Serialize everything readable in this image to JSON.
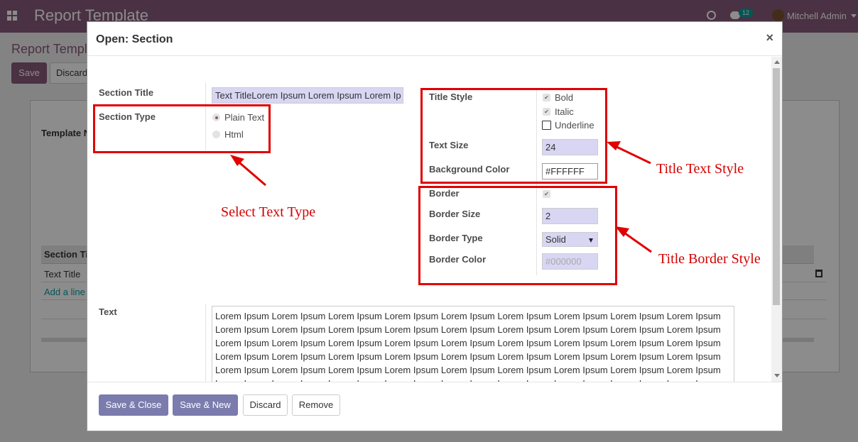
{
  "topbar": {
    "title": "Report Template",
    "badge": "12",
    "user": "Mitchell Admin"
  },
  "background": {
    "breadcrumb": "Report Templ",
    "save_label": "Save",
    "discard_label": "Discard",
    "template_label": "Template N",
    "table_header": "Section Ti",
    "row_title": "Text Title",
    "add_line": "Add a line"
  },
  "modal": {
    "title": "Open: Section",
    "close": "×",
    "section_title_label": "Section Title",
    "section_title_value": "Text TitleLorem Ipsum Lorem Ipsum Lorem Ip",
    "section_type_label": "Section Type",
    "section_type_options": [
      {
        "label": "Plain Text",
        "selected": true
      },
      {
        "label": "Html",
        "selected": false
      }
    ],
    "title_style_label": "Title Style",
    "title_style_options": [
      {
        "label": "Bold",
        "checked": true
      },
      {
        "label": "Italic",
        "checked": true
      },
      {
        "label": "Underline",
        "checked": false
      }
    ],
    "text_size_label": "Text Size",
    "text_size_value": "24",
    "bg_color_label": "Background Color",
    "bg_color_value": "#FFFFFF",
    "border_label": "Border",
    "border_checked": true,
    "border_size_label": "Border Size",
    "border_size_value": "2",
    "border_type_label": "Border Type",
    "border_type_value": "Solid",
    "border_color_label": "Border Color",
    "border_color_placeholder": "#000000",
    "text_label": "Text",
    "text_line": "Lorem Ipsum Lorem Ipsum Lorem Ipsum Lorem Ipsum Lorem Ipsum Lorem Ipsum Lorem Ipsum Lorem Ipsum Lorem Ipsum Lorem Ipsum Lorem Ipsum Lorem Ipsum Lorem Ipsum Lorem Ipsum Lorem Ipsum Lorem Ipsum Lorem Ipsum Lorem Ipsum Lorem Ipsum Lorem Ipsum Lorem Ipsum Lorem Ipsum Lorem Ipsum Lorem Ipsum Lorem Ipsum Lorem Ipsum Lorem Ipsum Lorem Ipsum Lorem Ipsum Lorem Ipsum Lorem Ipsum Lorem Ipsum Lorem Ipsum Lorem Ipsum Lorem Ipsum Lorem Ipsum Lorem Ipsum Lorem Ipsum Lorem Ipsum Lorem Ipsum Lorem Ipsum Lorem Ipsum Lorem Ipsum Lorem Ipsum Lorem Ipsum Lorem Ipsum Lorem Ipsum Lorem Ipsum Lorem Ipsum Lorem Ipsum Lorem Ipsum Lorem Ipsum Lorem Ipsum Lorem Ipsum Lorem Ipsum Lorem Ipsum Lorem Ipsum Lorem Ipsum Lorem Ipsum Lorem Ipsum Lorem Ipsum Lorem Ipsum Lorem Ipsum Lorem Ipsum Lorem Ipsum Lorem Ipsum Lorem Ipsum Lorem Ipsum Lorem Ipsum Lorem Ipsum Lorem Ipsum Lorem Ipsum Lorem Ipsum Lorem Ipsum Lorem Ipsum Lorem Ipsum Lorem Ipsum Lorem Ipsum"
  },
  "footer": {
    "save_close": "Save & Close",
    "save_new": "Save & New",
    "discard": "Discard",
    "remove": "Remove"
  },
  "annotations": {
    "select_text_type": "Select Text Type",
    "title_text_style": "Title Text Style",
    "title_border_style": "Title Border Style"
  },
  "colors": {
    "brand": "#875a7b",
    "primary_button": "#7c7bad",
    "annotation": "#e00000",
    "input_fill": "#d8d6f3"
  }
}
